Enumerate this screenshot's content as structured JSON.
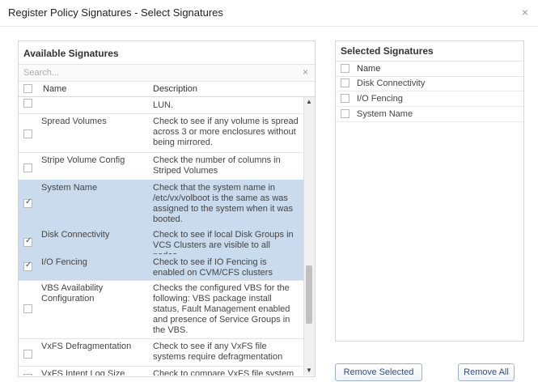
{
  "window": {
    "title": "Register Policy Signatures - Select Signatures",
    "close_glyph": "×"
  },
  "available": {
    "title": "Available Signatures",
    "search_placeholder": "Search...",
    "search_clear": "×",
    "columns": {
      "name": "Name",
      "description": "Description"
    },
    "rows": [
      {
        "name": "",
        "description": "LUN.",
        "checked": false,
        "selected": false
      },
      {
        "name": "Spread Volumes",
        "description": "Check to see if any volume is spread across 3 or more enclosures without being mirrored.",
        "checked": false,
        "selected": false
      },
      {
        "name": "Stripe Volume Config",
        "description": "Check the number of columns in Striped Volumes",
        "checked": false,
        "selected": false
      },
      {
        "name": "System Name",
        "description": "Check that the system name in /etc/vx/volboot is the same as was assigned to the system when it was booted.",
        "checked": true,
        "selected": true
      },
      {
        "name": "Disk Connectivity",
        "description": "Check to see if local Disk Groups in VCS Clusters are visible to all nodes.",
        "checked": true,
        "selected": true
      },
      {
        "name": "I/O Fencing",
        "description": "Check to see if IO Fencing is enabled on CVM/CFS clusters",
        "checked": true,
        "selected": true
      },
      {
        "name": "VBS Availability Configuration",
        "description": "Checks the configured VBS for the following: VBS package install status, Fault Management enabled and presence of Service Groups in the VBS.",
        "checked": false,
        "selected": false
      },
      {
        "name": "VxFS Defragmentation",
        "description": "Check to see if any VxFS file systems require defragmentation",
        "checked": false,
        "selected": false
      },
      {
        "name": "VxFS Intent Log Size",
        "description": "Check to compare VxFS file system size against the size of the intent log",
        "checked": false,
        "selected": false
      }
    ]
  },
  "selected": {
    "title": "Selected Signatures",
    "column_name": "Name",
    "rows": [
      {
        "name": "Disk Connectivity"
      },
      {
        "name": "I/O Fencing"
      },
      {
        "name": "System Name"
      }
    ]
  },
  "buttons": {
    "remove_selected": "Remove Selected",
    "remove_all": "Remove All"
  },
  "icons": {
    "scroll_up": "▲",
    "scroll_down": "▼"
  }
}
